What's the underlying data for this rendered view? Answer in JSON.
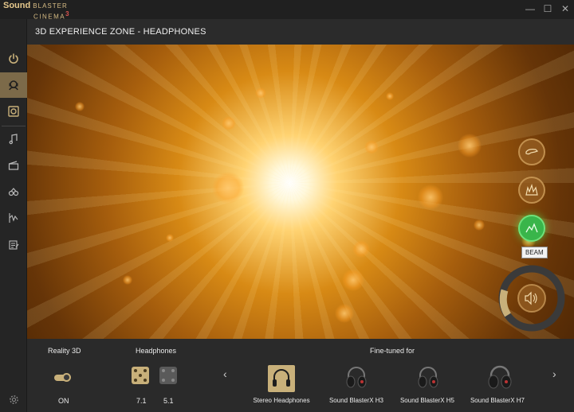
{
  "app": {
    "logo_line1": "Sound",
    "logo_line1b": "BLASTER",
    "logo_line2": "CINEMA",
    "logo_version": "3"
  },
  "window_controls": {
    "minimize": "—",
    "maximize": "☐",
    "close": "✕"
  },
  "sidebar": {
    "items": [
      {
        "name": "power",
        "active": false
      },
      {
        "name": "3d-experience",
        "active": true
      },
      {
        "name": "speaker",
        "active": false
      },
      {
        "name": "music",
        "active": false
      },
      {
        "name": "cinema",
        "active": false
      },
      {
        "name": "gaming",
        "active": false
      },
      {
        "name": "equalizer",
        "active": false
      },
      {
        "name": "notes",
        "active": false
      },
      {
        "name": "settings",
        "active": false
      }
    ]
  },
  "header": {
    "title": "3D EXPERIENCE ZONE - HEADPHONES"
  },
  "effects": {
    "buttons": [
      {
        "name": "gesture-effect",
        "active": false
      },
      {
        "name": "burst-effect",
        "active": false
      },
      {
        "name": "beam-effect",
        "active": true
      }
    ],
    "tooltip": "BEAM"
  },
  "panel": {
    "reality3d": {
      "label": "Reality 3D",
      "state": "ON"
    },
    "headphones": {
      "label": "Headphones",
      "options": [
        {
          "label": "7.1",
          "selected": true
        },
        {
          "label": "5.1",
          "selected": false
        }
      ]
    },
    "finetuned": {
      "label": "Fine-tuned for",
      "items": [
        {
          "label": "Stereo Headphones",
          "selected": true
        },
        {
          "label": "Sound BlasterX H3",
          "selected": false
        },
        {
          "label": "Sound BlasterX H5",
          "selected": false
        },
        {
          "label": "Sound BlasterX H7",
          "selected": false
        }
      ],
      "prev": "‹",
      "next": "›"
    }
  },
  "colors": {
    "accent": "#c8b07a",
    "active_effect": "#39b54a"
  }
}
